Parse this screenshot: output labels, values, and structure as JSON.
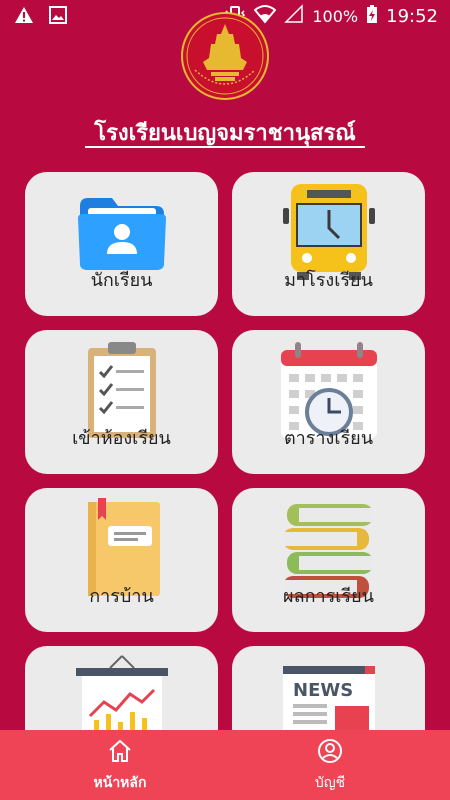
{
  "status": {
    "battery": "100%",
    "time": "19:52"
  },
  "school_name": "โรงเรียนเบญจมราชานุสรณ์",
  "menu": [
    {
      "label": "นักเรียน",
      "icon": "student-folder-icon"
    },
    {
      "label": "มาโรงเรียน",
      "icon": "school-bus-icon"
    },
    {
      "label": "เข้าห้องเรียน",
      "icon": "checklist-clipboard-icon"
    },
    {
      "label": "ตารางเรียน",
      "icon": "calendar-clock-icon"
    },
    {
      "label": "การบ้าน",
      "icon": "notebook-icon"
    },
    {
      "label": "ผลการเรียน",
      "icon": "stacked-books-icon"
    },
    {
      "label": "",
      "icon": "report-chart-icon"
    },
    {
      "label": "",
      "icon": "news-icon"
    }
  ],
  "bottom_nav": {
    "home": "หน้าหลัก",
    "account": "บัญชี"
  },
  "colors": {
    "background": "#b80a40",
    "bottom_nav": "#ee4456",
    "card": "#ebebeb"
  }
}
